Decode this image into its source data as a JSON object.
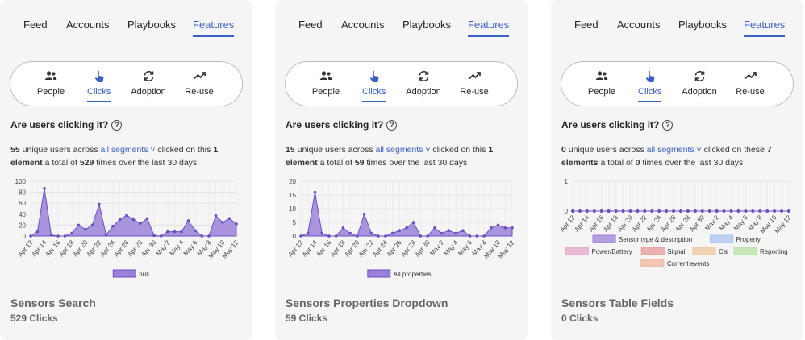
{
  "nav_tabs": [
    "Feed",
    "Accounts",
    "Playbooks",
    "Features"
  ],
  "sub_tabs": [
    {
      "label": "People",
      "icon": "people-icon"
    },
    {
      "label": "Clicks",
      "icon": "pointer-click-icon"
    },
    {
      "label": "Adoption",
      "icon": "refresh-icon"
    },
    {
      "label": "Re-use",
      "icon": "trending-up-icon"
    }
  ],
  "question": "Are users clicking it?",
  "help_glyph": "?",
  "colors": {
    "accent": "#3b5fc4",
    "series": "#9b82d9",
    "series_stroke": "#6b4fc0"
  },
  "panels": [
    {
      "desc": {
        "users": "55",
        "t1": " unique users across ",
        "segments": "all segments",
        "caret": " ˅",
        "t2": " clicked on this ",
        "count": "1",
        "unit": "element",
        "t3": " a total of ",
        "total": "529",
        "t4": " times over the last 30 days"
      },
      "title": "Sensors Search",
      "clicks": "529 Clicks",
      "chart_data": {
        "type": "area",
        "x": [
          "Apr 12",
          "Apr 13",
          "Apr 14",
          "Apr 15",
          "Apr 16",
          "Apr 17",
          "Apr 18",
          "Apr 19",
          "Apr 20",
          "Apr 21",
          "Apr 22",
          "Apr 23",
          "Apr 24",
          "Apr 25",
          "Apr 26",
          "Apr 27",
          "Apr 28",
          "Apr 29",
          "Apr 30",
          "May 1",
          "May 2",
          "May 3",
          "May 4",
          "May 5",
          "May 6",
          "May 7",
          "May 8",
          "May 9",
          "May 10",
          "May 11",
          "May 12"
        ],
        "tick_labels": [
          "Apr 12",
          "Apr 14",
          "Apr 16",
          "Apr 18",
          "Apr 20",
          "Apr 22",
          "Apr 24",
          "Apr 26",
          "Apr 28",
          "Apr 30",
          "May 2",
          "May 4",
          "May 6",
          "May 8",
          "May 10",
          "May 12"
        ],
        "yticks": [
          0,
          20,
          40,
          60,
          80,
          100
        ],
        "ylim": [
          0,
          100
        ],
        "series": [
          {
            "name": "null",
            "values": [
              0,
              8,
              87,
              2,
              0,
              0,
              5,
              20,
              12,
              20,
              58,
              2,
              18,
              30,
              38,
              30,
              23,
              32,
              1,
              0,
              8,
              8,
              8,
              28,
              10,
              0,
              0,
              37,
              25,
              32,
              22
            ]
          }
        ]
      }
    },
    {
      "desc": {
        "users": "15",
        "t1": " unique users across ",
        "segments": "all segments",
        "caret": " ˅",
        "t2": " clicked on this ",
        "count": "1",
        "unit": "element",
        "t3": " a total of ",
        "total": "59",
        "t4": " times over the last 30 days"
      },
      "title": "Sensors Properties Dropdown",
      "clicks": "59 Clicks",
      "chart_data": {
        "type": "area",
        "x": [
          "Apr 12",
          "Apr 13",
          "Apr 14",
          "Apr 15",
          "Apr 16",
          "Apr 17",
          "Apr 18",
          "Apr 19",
          "Apr 20",
          "Apr 21",
          "Apr 22",
          "Apr 23",
          "Apr 24",
          "Apr 25",
          "Apr 26",
          "Apr 27",
          "Apr 28",
          "Apr 29",
          "Apr 30",
          "May 1",
          "May 2",
          "May 3",
          "May 4",
          "May 5",
          "May 6",
          "May 7",
          "May 8",
          "May 9",
          "May 10",
          "May 11",
          "May 12"
        ],
        "tick_labels": [
          "Apr 12",
          "Apr 14",
          "Apr 16",
          "Apr 18",
          "Apr 20",
          "Apr 22",
          "Apr 24",
          "Apr 26",
          "Apr 28",
          "Apr 30",
          "May 2",
          "May 4",
          "May 6",
          "May 8",
          "May 10",
          "May 12"
        ],
        "yticks": [
          0,
          5,
          10,
          15,
          20
        ],
        "ylim": [
          0,
          20
        ],
        "series": [
          {
            "name": "All properties",
            "values": [
              0,
              1,
              16,
              1,
              0,
              0,
              3,
              1,
              0,
              8,
              1,
              0,
              0,
              1,
              2,
              3,
              5,
              0,
              0,
              3,
              1,
              2,
              1,
              2,
              0,
              0,
              0,
              3,
              4,
              3,
              3
            ]
          }
        ]
      }
    },
    {
      "desc": {
        "users": "0",
        "t1": " unique users across ",
        "segments": "all segments",
        "caret": " ˅",
        "t2": " clicked on these ",
        "count": "7",
        "unit": "elements",
        "t3": " a total of ",
        "total": "0",
        "t4": " times over the last 30 days"
      },
      "title": "Sensors Table Fields",
      "clicks": "0 Clicks",
      "chart_data": {
        "type": "area",
        "x": [
          "Apr 12",
          "Apr 13",
          "Apr 14",
          "Apr 15",
          "Apr 16",
          "Apr 17",
          "Apr 18",
          "Apr 19",
          "Apr 20",
          "Apr 21",
          "Apr 22",
          "Apr 23",
          "Apr 24",
          "Apr 25",
          "Apr 26",
          "Apr 27",
          "Apr 28",
          "Apr 29",
          "Apr 30",
          "May 1",
          "May 2",
          "May 3",
          "May 4",
          "May 5",
          "May 6",
          "May 7",
          "May 8",
          "May 9",
          "May 10",
          "May 11",
          "May 12"
        ],
        "tick_labels": [
          "Apr 12",
          "Apr 14",
          "Apr 16",
          "Apr 18",
          "Apr 20",
          "Apr 22",
          "Apr 24",
          "Apr 26",
          "Apr 28",
          "Apr 30",
          "May 2",
          "May 4",
          "May 6",
          "May 8",
          "May 10",
          "May 12"
        ],
        "yticks": [
          0,
          1
        ],
        "ylim": [
          0,
          1
        ],
        "series": [
          {
            "name": "Sensor type & description",
            "color": "#9b82d9",
            "values": [
              0,
              0,
              0,
              0,
              0,
              0,
              0,
              0,
              0,
              0,
              0,
              0,
              0,
              0,
              0,
              0,
              0,
              0,
              0,
              0,
              0,
              0,
              0,
              0,
              0,
              0,
              0,
              0,
              0,
              0,
              0
            ]
          },
          {
            "name": "Property",
            "color": "#a9c4f2",
            "values": [
              0,
              0,
              0,
              0,
              0,
              0,
              0,
              0,
              0,
              0,
              0,
              0,
              0,
              0,
              0,
              0,
              0,
              0,
              0,
              0,
              0,
              0,
              0,
              0,
              0,
              0,
              0,
              0,
              0,
              0,
              0
            ]
          },
          {
            "name": "Power/Battery",
            "color": "#e6a6c9",
            "values": [
              0,
              0,
              0,
              0,
              0,
              0,
              0,
              0,
              0,
              0,
              0,
              0,
              0,
              0,
              0,
              0,
              0,
              0,
              0,
              0,
              0,
              0,
              0,
              0,
              0,
              0,
              0,
              0,
              0,
              0,
              0
            ]
          },
          {
            "name": "Signal",
            "color": "#e69a9a",
            "values": [
              0,
              0,
              0,
              0,
              0,
              0,
              0,
              0,
              0,
              0,
              0,
              0,
              0,
              0,
              0,
              0,
              0,
              0,
              0,
              0,
              0,
              0,
              0,
              0,
              0,
              0,
              0,
              0,
              0,
              0,
              0
            ]
          },
          {
            "name": "Cal",
            "color": "#f2c69a",
            "values": [
              0,
              0,
              0,
              0,
              0,
              0,
              0,
              0,
              0,
              0,
              0,
              0,
              0,
              0,
              0,
              0,
              0,
              0,
              0,
              0,
              0,
              0,
              0,
              0,
              0,
              0,
              0,
              0,
              0,
              0,
              0
            ]
          },
          {
            "name": "Reporting",
            "color": "#b8e0a0",
            "values": [
              0,
              0,
              0,
              0,
              0,
              0,
              0,
              0,
              0,
              0,
              0,
              0,
              0,
              0,
              0,
              0,
              0,
              0,
              0,
              0,
              0,
              0,
              0,
              0,
              0,
              0,
              0,
              0,
              0,
              0,
              0
            ]
          },
          {
            "name": "Current events",
            "color": "#f0b59b",
            "values": [
              0,
              0,
              0,
              0,
              0,
              0,
              0,
              0,
              0,
              0,
              0,
              0,
              0,
              0,
              0,
              0,
              0,
              0,
              0,
              0,
              0,
              0,
              0,
              0,
              0,
              0,
              0,
              0,
              0,
              0,
              0
            ]
          }
        ]
      }
    }
  ]
}
